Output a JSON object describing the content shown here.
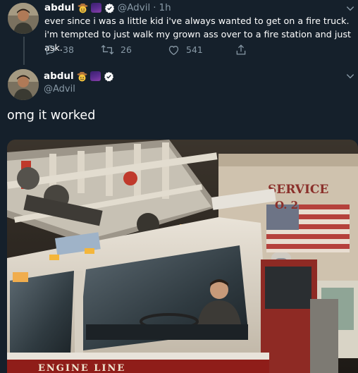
{
  "tweet1": {
    "name": "abdul",
    "handle": "@Advil",
    "separator": "·",
    "time": "1h",
    "text": "ever since i was a little kid i've always wanted to get on a fire truck. i'm tempted to just walk my grown ass over to a fire station and just ask.",
    "reply_count": "38",
    "retweet_count": "26",
    "like_count": "541"
  },
  "tweet2": {
    "name": "abdul",
    "handle": "@Advil",
    "text": "omg it worked",
    "photo": {
      "sign_text": "SERVICE",
      "sign_sub": "O. 2",
      "truck_text": "ENGINE LINE"
    }
  },
  "icons": [
    "reply-icon",
    "retweet-icon",
    "like-icon",
    "share-icon",
    "verified-badge-icon",
    "chevron-down-icon"
  ],
  "colors": {
    "background": "#15202b",
    "secondary_text": "#8899a6",
    "verified": "#ffffff"
  }
}
